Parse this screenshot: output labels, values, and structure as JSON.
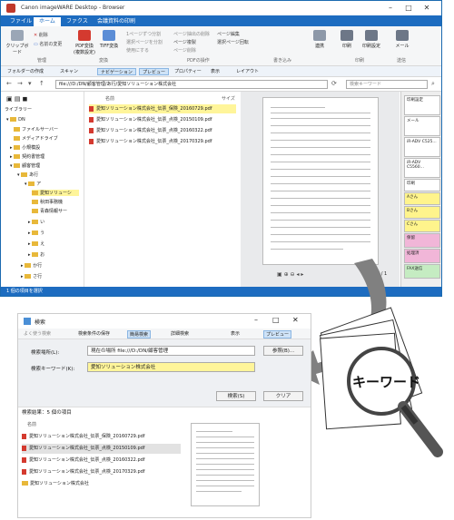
{
  "main_window": {
    "title": "Canon imageWARE Desktop - Browser",
    "menu": [
      "ファイル",
      "ホーム",
      "ファクス",
      "会議資料の印刷"
    ],
    "ribbon": {
      "clipboard": "クリップボード",
      "delete": "削除",
      "rename": "名前の変更",
      "pdf_convert": "PDF変換 (複数設定)",
      "tiff_convert": "TIFF変換",
      "convert_group": "変換",
      "manage_group": "管理",
      "page_ops": [
        "1ページずつ分割",
        "選択ページを分割",
        "使用にする",
        "ページ抽出の削除",
        "ページ複製",
        "ページ削除",
        "ページ編集",
        "選択ページ回転"
      ],
      "pdf_ops_group": "PDFの操作",
      "annotate_group": "書き込み",
      "continuous": "連携",
      "print": "印刷",
      "print_settings": "印刷設定",
      "print_group": "印刷",
      "mail": "メール",
      "send_group": "送信"
    },
    "toolbar": [
      "フォルダーの作成",
      "スキャン",
      "ナビゲーション",
      "プレビュー",
      "プロパティー",
      "表示",
      "レイアウト"
    ],
    "address": "file:///D:/DN/顧客管理/あ行/愛知ソリューション株式会社",
    "search_placeholder": "検索キーワード",
    "library_label": "ライブラリー",
    "tree": [
      "DN",
      "ファイルサーバー",
      "メディアドライブ",
      "小規模設",
      "契約書管理",
      "顧客管理",
      "あ行",
      "ア",
      "愛知ソリューシ",
      "秋田事務機",
      "青森情報サー",
      "い",
      "う",
      "え",
      "お",
      "か行",
      "さ行"
    ],
    "files_header": [
      "名前",
      "サイズ"
    ],
    "files": [
      "愛知ソリューション株式会社_伝票_保険_20160729.pdf",
      "愛知ソリューション株式会社_伝票_点検_20150109.pdf",
      "愛知ソリューション株式会社_伝票_点検_20160322.pdf",
      "愛知ソリューション株式会社_伝票_点検_20170329.pdf"
    ],
    "tray": [
      "印刷設定",
      "メール",
      "iR-ADV C525...",
      "iR-ADV C5560...",
      "印刷",
      "Aさん",
      "Bさん",
      "Cさん",
      "保留",
      "処理済",
      "FAX送信"
    ],
    "page_indicator": "1 / 1",
    "status": "1 個の項目を選択"
  },
  "search_window": {
    "title": "検索",
    "toolbar": [
      "よく使う検索",
      "検索条件の保存",
      "簡易検索",
      "詳細検索",
      "表示",
      "プレビュー"
    ],
    "location_label": "検索場所(L):",
    "location_value": "現在の場所 file:///D:/DN/顧客管理",
    "browse_button": "参照(B)...",
    "keyword_label": "検索キーワード(K):",
    "keyword_value": "愛知ソリューション株式会社",
    "search_button": "検索(S)",
    "clear_button": "クリア",
    "results_label": "検索結果：5 個の項目",
    "results_header": "名前",
    "results": [
      "愛知ソリューション株式会社_伝票_保険_20160729.pdf",
      "愛知ソリューション株式会社_伝票_点検_20150109.pdf",
      "愛知ソリューション株式会社_伝票_点検_20160322.pdf",
      "愛知ソリューション株式会社_伝票_点検_20170329.pdf",
      "愛知ソリューション株式会社"
    ]
  },
  "illustration": {
    "keyword_text": "キーワード"
  },
  "colors": {
    "accent": "#1d6cc0",
    "highlight": "#fff59a",
    "arrow": "#7f7f7f"
  }
}
